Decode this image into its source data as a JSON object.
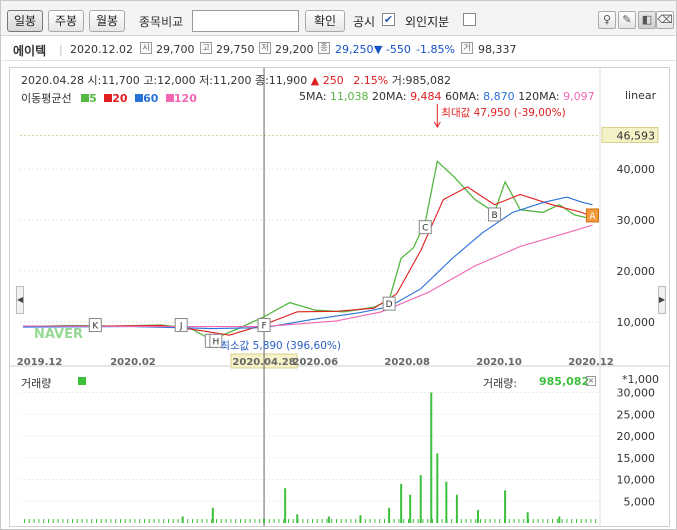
{
  "toolbar": {
    "period_buttons": [
      {
        "label": "일봉",
        "active": true
      },
      {
        "label": "주봉",
        "active": false
      },
      {
        "label": "월봉",
        "active": false
      }
    ],
    "compare_label": "종목비교",
    "compare_value": "",
    "confirm_label": "확인",
    "announce_label": "공시",
    "announce_checked": true,
    "foreign_label": "외인지분",
    "foreign_checked": false
  },
  "info": {
    "name": "에이텍",
    "date": "2020.12.02",
    "open_label": "시",
    "open": "29,700",
    "high_label": "고",
    "high": "29,750",
    "low_label": "저",
    "low": "29,200",
    "close_label": "종",
    "close": "29,250",
    "change": "▼ -550",
    "change_pct": "-1.85%",
    "volume_label": "거",
    "volume": "98,337",
    "colors": {
      "down": "#1450c8",
      "up": "#e02020"
    }
  },
  "hover": {
    "date": "2020.04.28",
    "open_label": "시:",
    "open": "11,700",
    "high_label": "고:",
    "high": "12,000",
    "low_label": "저:",
    "low": "11,200",
    "close_label": "종:",
    "close": "11,900",
    "change": "▲ 250",
    "change_pct": "2.15%",
    "volume_label": "거:",
    "volume": "985,082"
  },
  "ma_legend": {
    "title": "이동평균선",
    "items": [
      {
        "label": "5",
        "color": "#55b642"
      },
      {
        "label": "20",
        "color": "#e02020"
      },
      {
        "label": "60",
        "color": "#2a72d8"
      },
      {
        "label": "120",
        "color": "#f266b2"
      }
    ],
    "values": [
      {
        "label": "5MA:",
        "value": "11,038",
        "color": "#55b642"
      },
      {
        "label": "20MA:",
        "value": "9,484",
        "color": "#e02020"
      },
      {
        "label": "60MA:",
        "value": "8,870",
        "color": "#2a72d8"
      },
      {
        "label": "120MA:",
        "value": "9,097",
        "color": "#f266b2"
      }
    ],
    "scale_label": "linear"
  },
  "annotations": {
    "max_label": "최대값 47,950 (-39,00%)",
    "min_label": "최소값 5,890 (396,60%)",
    "last_price_tag": "46,593",
    "crosshair_date": "2020.04.28",
    "logo": "NAVER",
    "markers": [
      {
        "letter": "K",
        "date": "2020.01.07",
        "price": 9300
      },
      {
        "letter": "J",
        "date": "2020.03.04",
        "price": 9300
      },
      {
        "letter": "I",
        "date": "2020.03.24",
        "price": 6200
      },
      {
        "letter": "H",
        "date": "2020.03.27",
        "price": 6200
      },
      {
        "letter": "F",
        "date": "2020.04.28",
        "price": 9300
      },
      {
        "letter": "D",
        "date": "2020.07.20",
        "price": 13500
      },
      {
        "letter": "C",
        "date": "2020.08.13",
        "price": 28500
      },
      {
        "letter": "B",
        "date": "2020.09.28",
        "price": 31000
      },
      {
        "letter": "A",
        "date": "2020.12.02",
        "price": 30800
      }
    ]
  },
  "volume_panel": {
    "title": "거래량",
    "value_label": "거래량:",
    "value": "985,082",
    "unit": "*1,000",
    "color": "#3cc03c"
  },
  "chart_data": {
    "type": "line",
    "price_axis": {
      "ticks": [
        10000,
        20000,
        30000,
        40000
      ],
      "ylim": [
        4500,
        51000
      ]
    },
    "volume_axis": {
      "ticks": [
        5000,
        10000,
        15000,
        20000,
        25000,
        30000
      ],
      "ylim": [
        0,
        31500
      ]
    },
    "x_labels": [
      "2019.12",
      "2020.02",
      "2020.04.28",
      "2020.06",
      "2020.08",
      "2020.10",
      "2020.12"
    ],
    "x_range": [
      "2019.11.18",
      "2020.12.07"
    ],
    "series": [
      {
        "name": "5",
        "values": [
          [
            "2019.11.20",
            9100
          ],
          [
            "2019.12.20",
            9300
          ],
          [
            "2020.01.20",
            9200
          ],
          [
            "2020.02.20",
            9400
          ],
          [
            "2020.03.10",
            8800
          ],
          [
            "2020.03.24",
            6500
          ],
          [
            "2020.04.10",
            8600
          ],
          [
            "2020.04.28",
            11038
          ],
          [
            "2020.05.15",
            13800
          ],
          [
            "2020.06.01",
            12300
          ],
          [
            "2020.06.20",
            12000
          ],
          [
            "2020.07.10",
            12900
          ],
          [
            "2020.07.20",
            14300
          ],
          [
            "2020.07.28",
            22500
          ],
          [
            "2020.08.05",
            24500
          ],
          [
            "2020.08.13",
            29500
          ],
          [
            "2020.08.21",
            41500
          ],
          [
            "2020.09.01",
            38500
          ],
          [
            "2020.09.15",
            34000
          ],
          [
            "2020.09.28",
            31500
          ],
          [
            "2020.10.05",
            37500
          ],
          [
            "2020.10.15",
            32000
          ],
          [
            "2020.10.30",
            31500
          ],
          [
            "2020.11.10",
            33000
          ],
          [
            "2020.11.20",
            31000
          ],
          [
            "2020.12.02",
            30200
          ]
        ]
      },
      {
        "name": "20",
        "values": [
          [
            "2019.11.20",
            9100
          ],
          [
            "2020.01.15",
            9200
          ],
          [
            "2020.02.20",
            9300
          ],
          [
            "2020.03.15",
            8400
          ],
          [
            "2020.04.05",
            7400
          ],
          [
            "2020.04.28",
            9484
          ],
          [
            "2020.05.20",
            12000
          ],
          [
            "2020.06.15",
            12100
          ],
          [
            "2020.07.10",
            12700
          ],
          [
            "2020.07.25",
            15500
          ],
          [
            "2020.08.10",
            24000
          ],
          [
            "2020.08.25",
            34000
          ],
          [
            "2020.09.10",
            36500
          ],
          [
            "2020.09.28",
            33000
          ],
          [
            "2020.10.15",
            35000
          ],
          [
            "2020.11.05",
            33000
          ],
          [
            "2020.11.25",
            31500
          ],
          [
            "2020.12.02",
            30600
          ]
        ]
      },
      {
        "name": "60",
        "values": [
          [
            "2019.11.20",
            9000
          ],
          [
            "2020.02.01",
            9100
          ],
          [
            "2020.03.25",
            8700
          ],
          [
            "2020.04.28",
            8870
          ],
          [
            "2020.05.30",
            10500
          ],
          [
            "2020.06.30",
            11800
          ],
          [
            "2020.07.20",
            13000
          ],
          [
            "2020.08.10",
            16500
          ],
          [
            "2020.08.31",
            22500
          ],
          [
            "2020.09.20",
            27500
          ],
          [
            "2020.10.10",
            31500
          ],
          [
            "2020.10.31",
            33500
          ],
          [
            "2020.11.15",
            34500
          ],
          [
            "2020.11.25",
            33500
          ],
          [
            "2020.12.02",
            33000
          ]
        ]
      },
      {
        "name": "120",
        "values": [
          [
            "2019.11.20",
            9200
          ],
          [
            "2020.03.01",
            9100
          ],
          [
            "2020.04.28",
            9097
          ],
          [
            "2020.06.15",
            10200
          ],
          [
            "2020.07.15",
            12000
          ],
          [
            "2020.08.15",
            15800
          ],
          [
            "2020.09.15",
            21000
          ],
          [
            "2020.10.15",
            24800
          ],
          [
            "2020.11.15",
            27500
          ],
          [
            "2020.12.02",
            29000
          ]
        ]
      }
    ],
    "volume": [
      [
        "2020.03.05",
        1500
      ],
      [
        "2020.03.25",
        3500
      ],
      [
        "2020.04.28",
        985
      ],
      [
        "2020.05.12",
        8000
      ],
      [
        "2020.05.20",
        2000
      ],
      [
        "2020.06.10",
        1500
      ],
      [
        "2020.07.01",
        1800
      ],
      [
        "2020.07.20",
        3500
      ],
      [
        "2020.07.28",
        9000
      ],
      [
        "2020.08.03",
        6500
      ],
      [
        "2020.08.10",
        11000
      ],
      [
        "2020.08.17",
        30000
      ],
      [
        "2020.08.21",
        16000
      ],
      [
        "2020.08.27",
        9500
      ],
      [
        "2020.09.03",
        6500
      ],
      [
        "2020.09.17",
        3000
      ],
      [
        "2020.10.05",
        7500
      ],
      [
        "2020.10.20",
        2500
      ],
      [
        "2020.11.10",
        1500
      ]
    ]
  }
}
